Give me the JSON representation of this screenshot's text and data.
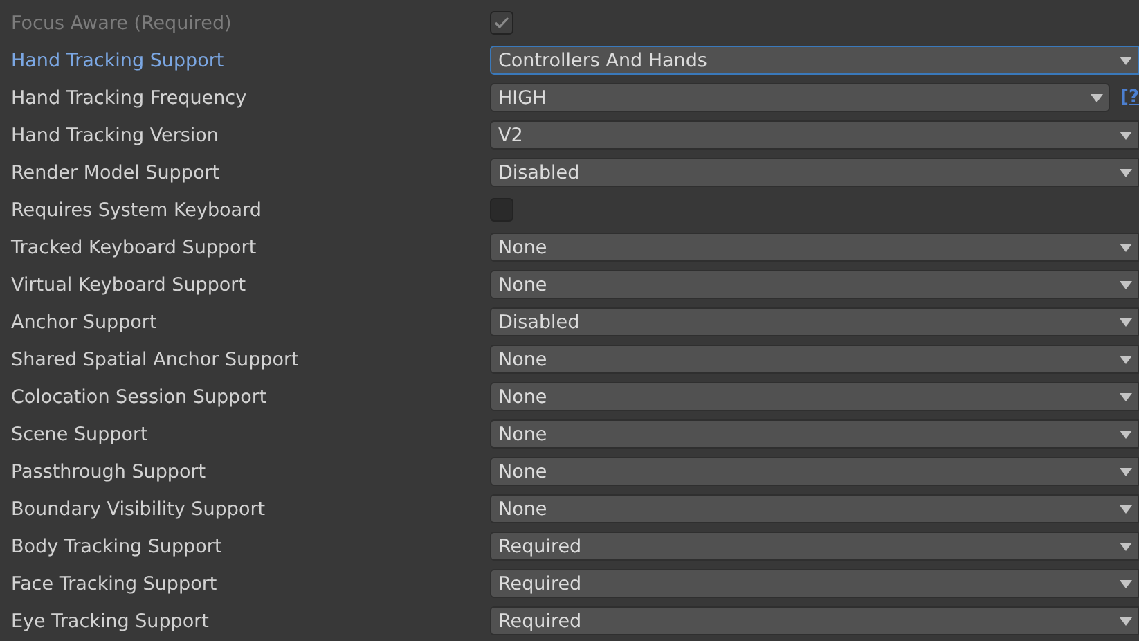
{
  "settings": [
    {
      "label": "Focus Aware (Required)",
      "kind": "checkbox",
      "checked": true,
      "disabled": true
    },
    {
      "label": "Hand Tracking Support",
      "kind": "dropdown",
      "value": "Controllers And Hands",
      "focused": true
    },
    {
      "label": "Hand Tracking Frequency",
      "kind": "dropdown",
      "value": "HIGH",
      "help": "[?"
    },
    {
      "label": "Hand Tracking Version",
      "kind": "dropdown",
      "value": "V2"
    },
    {
      "label": "Render Model Support",
      "kind": "dropdown",
      "value": "Disabled"
    },
    {
      "label": "Requires System Keyboard",
      "kind": "checkbox",
      "checked": false
    },
    {
      "label": "Tracked Keyboard Support",
      "kind": "dropdown",
      "value": "None"
    },
    {
      "label": "Virtual Keyboard Support",
      "kind": "dropdown",
      "value": "None"
    },
    {
      "label": "Anchor Support",
      "kind": "dropdown",
      "value": "Disabled"
    },
    {
      "label": "Shared Spatial Anchor Support",
      "kind": "dropdown",
      "value": "None"
    },
    {
      "label": "Colocation Session Support",
      "kind": "dropdown",
      "value": "None"
    },
    {
      "label": "Scene Support",
      "kind": "dropdown",
      "value": "None"
    },
    {
      "label": "Passthrough Support",
      "kind": "dropdown",
      "value": "None"
    },
    {
      "label": "Boundary Visibility Support",
      "kind": "dropdown",
      "value": "None"
    },
    {
      "label": "Body Tracking Support",
      "kind": "dropdown",
      "value": "Required"
    },
    {
      "label": "Face Tracking Support",
      "kind": "dropdown",
      "value": "Required"
    },
    {
      "label": "Eye Tracking Support",
      "kind": "dropdown",
      "value": "Required"
    }
  ]
}
